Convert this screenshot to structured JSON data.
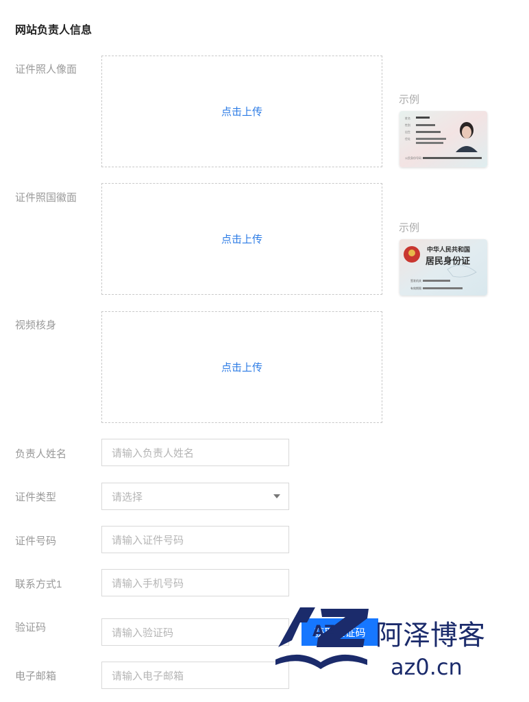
{
  "section": {
    "title": "网站负责人信息"
  },
  "uploads": [
    {
      "label": "证件照人像面",
      "action": "点击上传",
      "example_label": "示例"
    },
    {
      "label": "证件照国徽面",
      "action": "点击上传",
      "example_label": "示例"
    },
    {
      "label": "视频核身",
      "action": "点击上传"
    }
  ],
  "id_front_card": {
    "name_field": "姓名",
    "sex_field": "性别",
    "birth_field": "出生",
    "address_field": "住址",
    "id_field": "公民身份号码"
  },
  "id_back_card": {
    "line1": "中华人民共和国",
    "line2": "居民身份证",
    "authority_label": "签发机关",
    "validity_label": "有效期限"
  },
  "form": {
    "name": {
      "label": "负责人姓名",
      "placeholder": "请输入负责人姓名"
    },
    "id_type": {
      "label": "证件类型",
      "placeholder": "请选择"
    },
    "id_number": {
      "label": "证件号码",
      "placeholder": "请输入证件号码"
    },
    "contact": {
      "label": "联系方式1",
      "placeholder": "请输入手机号码"
    },
    "code": {
      "label": "验证码",
      "placeholder": "请输入验证码",
      "button": "获取验证码"
    },
    "email": {
      "label": "电子邮箱",
      "placeholder": "请输入电子邮箱"
    }
  },
  "watermark": {
    "brand_cn": "阿泽博客",
    "domain": "az0.cn",
    "logo_text": "AZ"
  },
  "colors": {
    "accent": "#1677ff",
    "link": "#2c7be5",
    "watermark": "#1b2b6b"
  }
}
